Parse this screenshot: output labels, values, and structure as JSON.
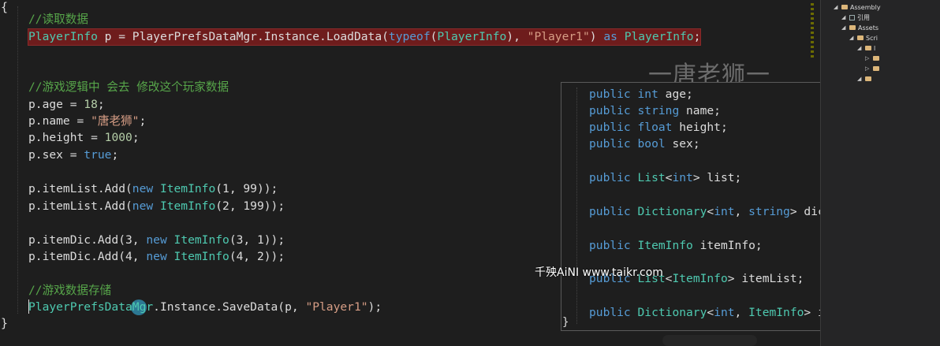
{
  "editor": {
    "open_brace": "{",
    "close_brace": "}",
    "comment_read": "//读取数据",
    "load_line": {
      "type1": "PlayerInfo",
      "rest1": " p = PlayerPrefsDataMgr.Instance.LoadData(",
      "kw_typeof": "typeof",
      "rest2": "(",
      "type2": "PlayerInfo",
      "rest3": "), ",
      "str": "\"Player1\"",
      "rest4": ") ",
      "kw_as": "as",
      "rest5": " ",
      "type3": "PlayerInfo",
      "rest6": ";"
    },
    "comment_logic": "//游戏逻辑中 会去 修改这个玩家数据",
    "age_line": {
      "pre": "p.age = ",
      "num": "18",
      "post": ";"
    },
    "name_line": {
      "pre": "p.name = ",
      "str": "\"唐老狮\"",
      "post": ";"
    },
    "height_line": {
      "pre": "p.height = ",
      "num": "1000",
      "post": ";"
    },
    "sex_line": {
      "pre": "p.sex = ",
      "kw": "true",
      "post": ";"
    },
    "list_add_1": {
      "pre": "p.itemList.Add(",
      "kw": "new",
      "sp": " ",
      "type": "ItemInfo",
      "args": "(1, 99));"
    },
    "list_add_2": {
      "pre": "p.itemList.Add(",
      "kw": "new",
      "sp": " ",
      "type": "ItemInfo",
      "args": "(2, 199));"
    },
    "dic_add_1": {
      "pre": "p.itemDic.Add(3, ",
      "kw": "new",
      "sp": " ",
      "type": "ItemInfo",
      "args": "(3, 1));"
    },
    "dic_add_2": {
      "pre": "p.itemDic.Add(4, ",
      "kw": "new",
      "sp": " ",
      "type": "ItemInfo",
      "args": "(4, 2));"
    },
    "comment_save": "//游戏数据存储",
    "save_line": {
      "type": "PlayerPrefsDataMgr",
      "rest": ".Instance.SaveData(p, ",
      "str": "\"Player1\"",
      "post": ");"
    }
  },
  "watermark_name": "一唐老狮一",
  "watermark_site": "千殃AiNI www.taikr.com",
  "popup": {
    "lines": [
      {
        "kw": "public",
        "type_kw": "int",
        "rest": " age;"
      },
      {
        "kw": "public",
        "type_kw": "string",
        "rest": " name;"
      },
      {
        "kw": "public",
        "type_kw": "float",
        "rest": " height;"
      },
      {
        "kw": "public",
        "type_kw": "bool",
        "rest": " sex;"
      },
      {
        "kw": "public",
        "t1": "List",
        "a": "<",
        "k1": "int",
        "b": "> list;"
      },
      {
        "kw": "public",
        "t1": "Dictionary",
        "a": "<",
        "k1": "int",
        "c": ", ",
        "k2": "string",
        "b": "> dic;"
      },
      {
        "kw": "public",
        "t1": "ItemInfo",
        "b": " itemInfo;"
      },
      {
        "kw": "public",
        "t1": "List",
        "a": "<",
        "t2": "ItemInfo",
        "b": "> itemList;"
      },
      {
        "kw": "public",
        "t1": "Dictionary",
        "a": "<",
        "k1": "int",
        "c": ", ",
        "t2": "ItemInfo",
        "b": "> itemDic;"
      }
    ],
    "close_brace": "}"
  },
  "solution_explorer": {
    "items": [
      {
        "label": "Assembly",
        "indent": 0,
        "kind": "project"
      },
      {
        "label": "引用",
        "indent": 1,
        "kind": "ref"
      },
      {
        "label": "Assets",
        "indent": 1,
        "kind": "folder"
      },
      {
        "label": "Scri",
        "indent": 2,
        "kind": "folder"
      },
      {
        "label": "l",
        "indent": 3,
        "kind": "folder"
      },
      {
        "label": "",
        "indent": 4,
        "kind": "file"
      },
      {
        "label": "",
        "indent": 4,
        "kind": "file"
      },
      {
        "label": "",
        "indent": 3,
        "kind": "folder"
      }
    ]
  }
}
